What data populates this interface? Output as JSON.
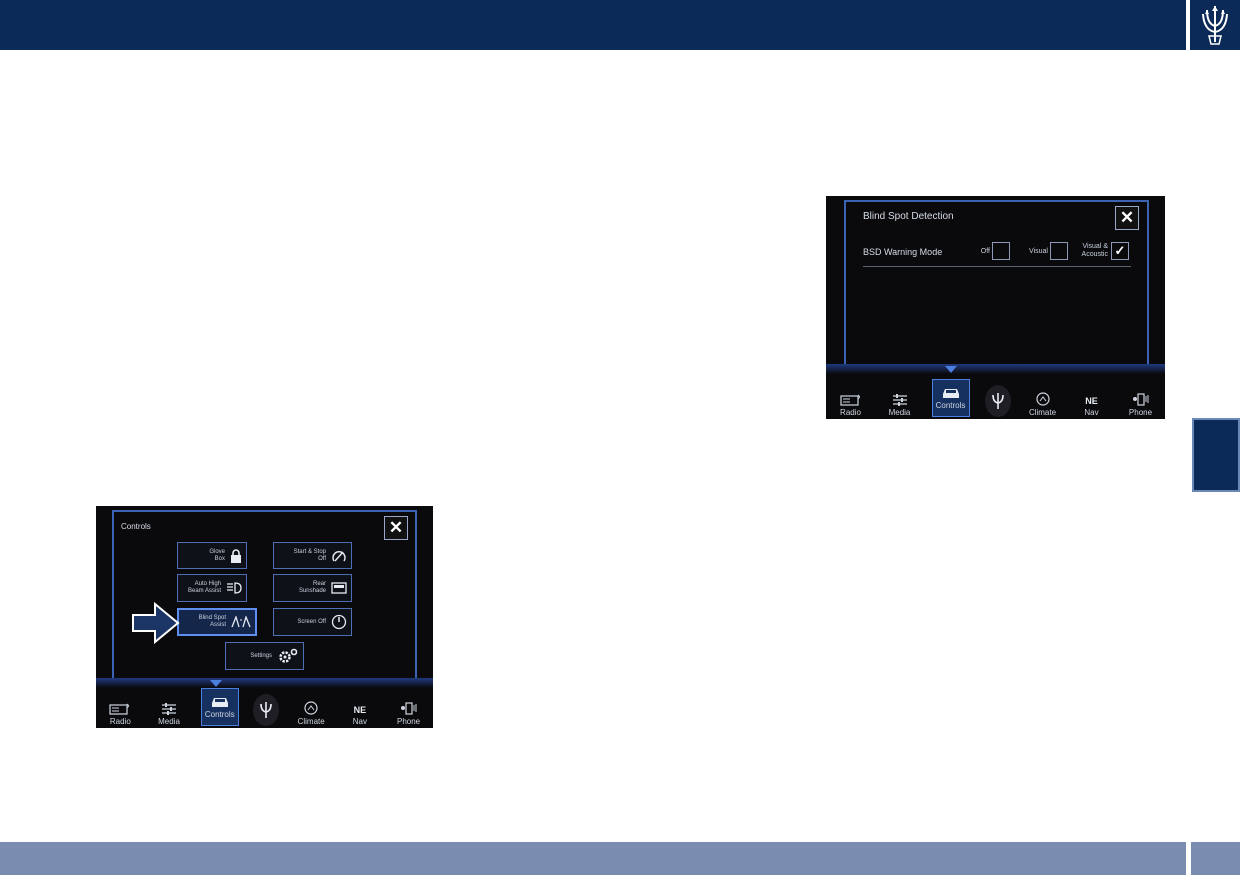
{
  "header": {
    "logo_icon": "trident-logo-icon"
  },
  "colors": {
    "header": "#0b2a57",
    "footer": "#7a8db1",
    "accent": "#3c63b3"
  },
  "controls_screen": {
    "title": "Controls",
    "close_label": "✕",
    "buttons": [
      {
        "label_line1": "Glove",
        "label_line2": "Box",
        "icon": "lock-icon"
      },
      {
        "label_line1": "Start & Stop",
        "label_line2": "Off",
        "icon": "start-stop-icon"
      },
      {
        "label_line1": "Auto High",
        "label_line2": "Beam Assist",
        "icon": "high-beam-icon"
      },
      {
        "label_line1": "Rear",
        "label_line2": "Sunshade",
        "icon": "sunshade-icon"
      },
      {
        "label_line1": "Blind Spot",
        "label_line2": "Assist",
        "icon": "blind-spot-icon"
      },
      {
        "label_line1": "Screen Off",
        "label_line2": "",
        "icon": "power-icon"
      },
      {
        "label_line1": "Settings",
        "label_line2": "",
        "icon": "settings-icon"
      }
    ],
    "nav": [
      "Radio",
      "Media",
      "Controls",
      "",
      "Climate",
      "Nav",
      "Phone"
    ],
    "nav_compass": "NE"
  },
  "bsd_screen": {
    "title": "Blind Spot Detection",
    "close_label": "✕",
    "row_label": "BSD Warning Mode",
    "options": [
      {
        "label_line1": "Off",
        "label_line2": "",
        "checked": false
      },
      {
        "label_line1": "Visual",
        "label_line2": "",
        "checked": false
      },
      {
        "label_line1": "Visual &",
        "label_line2": "Acoustic",
        "checked": true
      }
    ],
    "check_mark": "✓",
    "nav": [
      "Radio",
      "Media",
      "Controls",
      "",
      "Climate",
      "Nav",
      "Phone"
    ],
    "nav_compass": "NE"
  }
}
